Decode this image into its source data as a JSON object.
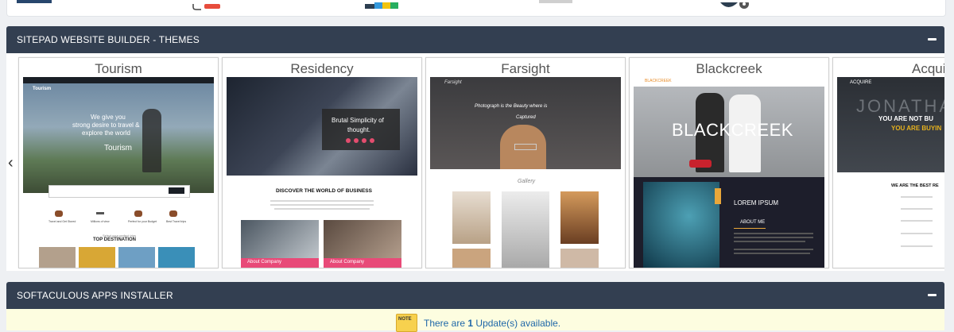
{
  "top_icons": [
    "dashboard-icon",
    "chat-badge-icon",
    "tags-icon",
    "box-icon",
    "settings-gear-icon"
  ],
  "sitepad": {
    "title": "SITEPAD WEBSITE BUILDER - THEMES",
    "themes": [
      {
        "name": "Tourism",
        "preview": {
          "line1": "We give you",
          "line2": "strong desire to travel &",
          "line3": "explore the world",
          "hero": "Tourism",
          "section": "TOP DESTINATION",
          "pre_section": "Select your perfect trips",
          "logo": "Tourism",
          "features": [
            "Travel and Get Stored",
            "Millions of view",
            "Perfect for your Budget",
            "Best Travel trips"
          ]
        }
      },
      {
        "name": "Residency",
        "preview": {
          "headline": "Brutal Simplicity of thought.",
          "section": "DISCOVER THE WORLD OF BUSINESS",
          "card1": "About Company",
          "card2": "About Company"
        }
      },
      {
        "name": "Farsight",
        "preview": {
          "logo": "Farsight",
          "tagline1": "Photograph is the Beauty where is",
          "tagline2": "Captured",
          "gallery": "Gallery"
        }
      },
      {
        "name": "Blackcreek",
        "preview": {
          "logo": "BLACKCREEK",
          "hero": "BLACKCREEK",
          "lorem": "LOREM IPSUM",
          "about": "ABOUT ME"
        }
      },
      {
        "name": "Acquire",
        "preview": {
          "logo": "ACQUIRE",
          "bg_word": "JONATHA",
          "line1": "YOU ARE NOT BU",
          "line2": "YOU ARE BUYIN",
          "section": "WE ARE THE BEST RE"
        }
      }
    ]
  },
  "softaculous": {
    "title": "SOFTACULOUS APPS INSTALLER",
    "note_label": "NOTE",
    "updates_prefix": "There are",
    "updates_count": "1",
    "updates_suffix": "Update(s) available."
  },
  "colors": {
    "header_bg": "#333f51",
    "accent": "#1f67a8",
    "note_bg": "#fdfde0"
  }
}
